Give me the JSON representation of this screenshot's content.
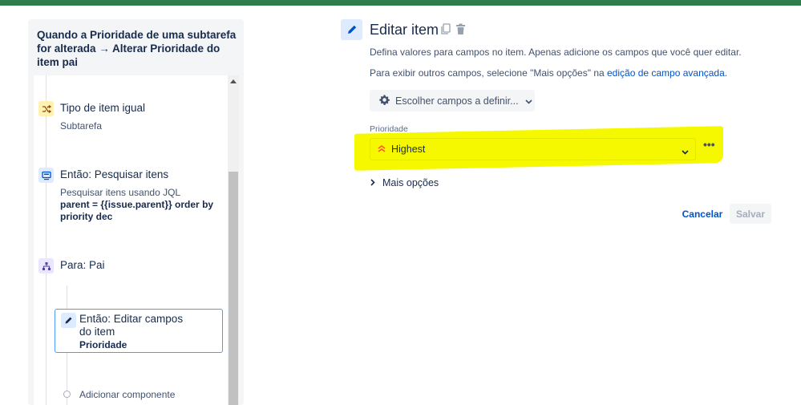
{
  "rule": {
    "title": "Quando a Prioridade de uma subtarefa for alterada → Alterar Prioridade do item pai"
  },
  "components": [
    {
      "title": "Tipo de item igual",
      "subtitle": "Subtarefa",
      "icon": "shuffle-icon",
      "color": "#fff0b3"
    },
    {
      "title": "Então: Pesquisar itens",
      "subtitle": "Pesquisar itens usando JQL",
      "subtitle_bold": "parent = {{issue.parent}} order by priority dec",
      "icon": "search-items-icon",
      "color": "#deebff"
    },
    {
      "title": "Para: Pai",
      "icon": "hierarchy-icon",
      "color": "#eae6ff"
    },
    {
      "title_line1": "Então: Editar campos",
      "title_line2": "do item",
      "subtitle_bold": "Prioridade",
      "icon": "pencil-icon",
      "color": "#deebff"
    }
  ],
  "add_component": "Adicionar componente",
  "editor": {
    "title": "Editar item",
    "description": "Defina valores para campos no item. Apenas adicione os campos que você quer editar.",
    "more_fields_prefix": "Para exibir outros campos, selecione \"Mais opções\" na ",
    "more_fields_link": "edição de campo avançada",
    "more_fields_suffix": ".",
    "choose_fields": "Escolher campos a definir...",
    "field_label": "Prioridade",
    "field_value": "Highest",
    "more_options": "Mais opções",
    "cancel": "Cancelar",
    "save": "Salvar"
  },
  "colors": {
    "highlight": "#f6f800",
    "link": "#0052cc",
    "priority_highest": "#ff5630",
    "top_bar": "#2e7d4f"
  }
}
